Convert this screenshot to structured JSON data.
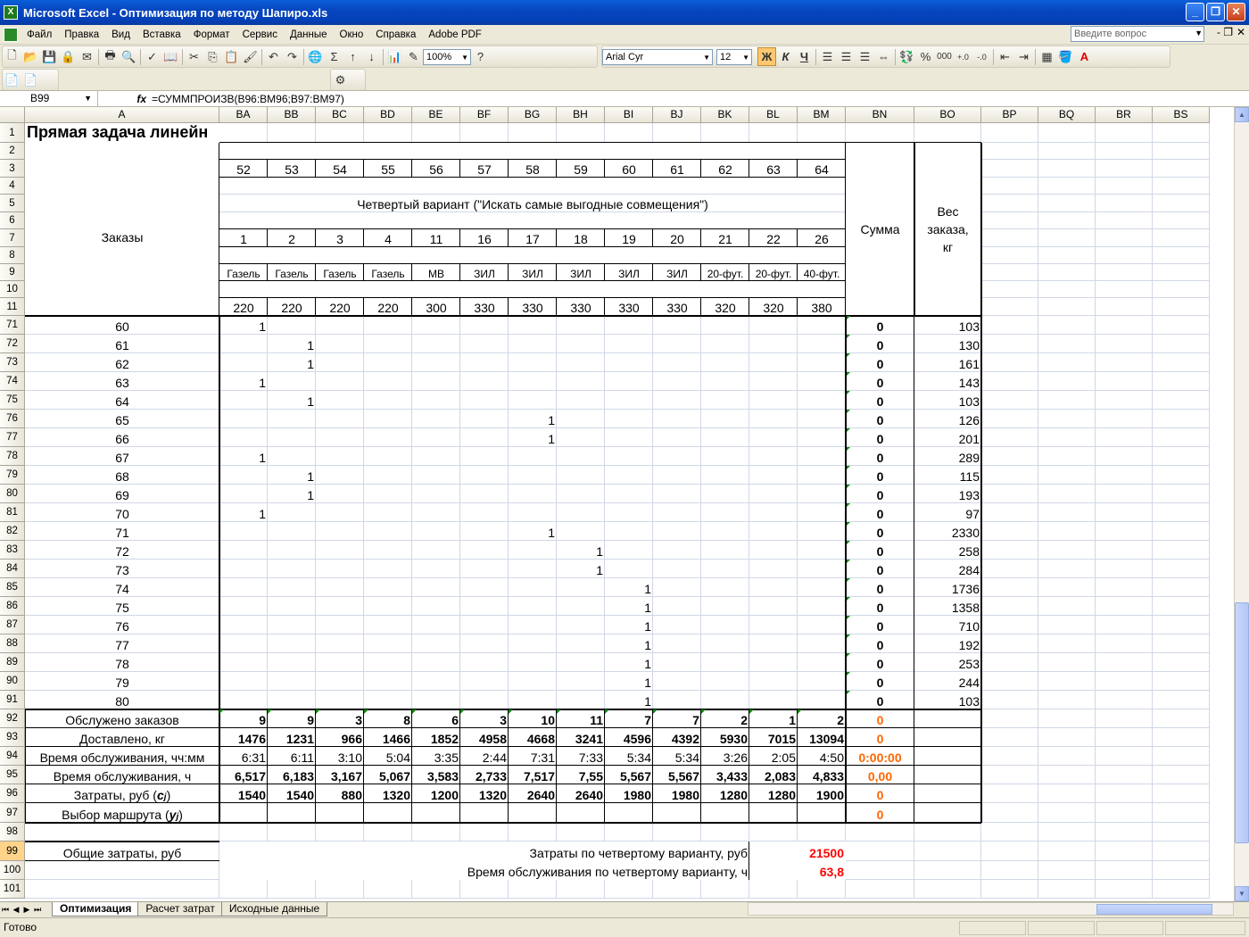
{
  "window": {
    "title": "Microsoft Excel - Оптимизация по методу Шапиро.xls"
  },
  "menu": {
    "items": [
      "Файл",
      "Правка",
      "Вид",
      "Вставка",
      "Формат",
      "Сервис",
      "Данные",
      "Окно",
      "Справка",
      "Adobe PDF"
    ],
    "ask_placeholder": "Введите вопрос"
  },
  "toolbar": {
    "zoom": "100%",
    "font": "Arial Cyr",
    "size": "12",
    "bold": "Ж",
    "italic": "К",
    "underline": "Ч"
  },
  "formula_bar": {
    "name_box": "B99",
    "fx": "fx",
    "formula": "=СУММПРОИЗВ(B96:BM96;B97:BM97)"
  },
  "sheet": {
    "columns": [
      "A",
      "BA",
      "BB",
      "BC",
      "BD",
      "BE",
      "BF",
      "BG",
      "BH",
      "BI",
      "BJ",
      "BK",
      "BL",
      "BM",
      "BN",
      "BO",
      "BP",
      "BQ",
      "BR",
      "BS"
    ],
    "row_numbers": [
      "1",
      "2",
      "3",
      "4",
      "5",
      "6",
      "7",
      "8",
      "9",
      "10",
      "11",
      "71",
      "72",
      "73",
      "74",
      "75",
      "76",
      "77",
      "78",
      "79",
      "80",
      "81",
      "82",
      "83",
      "84",
      "85",
      "86",
      "87",
      "88",
      "89",
      "90",
      "91",
      "92",
      "93",
      "94",
      "95",
      "96",
      "97",
      "98",
      "99",
      "100",
      "101"
    ],
    "selected_row": "99",
    "title": "Прямая задача линейн",
    "orders_label": "Заказы",
    "variant_label": "Четвертый вариант (\"Искать самые выгодные совмещения\")",
    "sum_label": "Сумма",
    "weight_label": [
      "Вес",
      "заказа,",
      "кг"
    ],
    "route_numbers": [
      "52",
      "53",
      "54",
      "55",
      "56",
      "57",
      "58",
      "59",
      "60",
      "61",
      "62",
      "63",
      "64"
    ],
    "vehicle_numbers": [
      "1",
      "2",
      "3",
      "4",
      "11",
      "16",
      "17",
      "18",
      "19",
      "20",
      "21",
      "22",
      "26"
    ],
    "vehicle_types": [
      "Газель",
      "Газель",
      "Газель",
      "Газель",
      "МВ",
      "ЗИЛ",
      "ЗИЛ",
      "ЗИЛ",
      "ЗИЛ",
      "ЗИЛ",
      "20-фут.",
      "20-фут.",
      "40-фут."
    ],
    "vehicle_cost": [
      "220",
      "220",
      "220",
      "220",
      "300",
      "330",
      "330",
      "330",
      "330",
      "330",
      "320",
      "320",
      "380"
    ],
    "order_rows": [
      {
        "order": "60",
        "col": 0,
        "sum": "0",
        "weight": "103"
      },
      {
        "order": "61",
        "col": 1,
        "sum": "0",
        "weight": "130"
      },
      {
        "order": "62",
        "col": 1,
        "sum": "0",
        "weight": "161"
      },
      {
        "order": "63",
        "col": 0,
        "sum": "0",
        "weight": "143"
      },
      {
        "order": "64",
        "col": 1,
        "sum": "0",
        "weight": "103"
      },
      {
        "order": "65",
        "col": 6,
        "sum": "0",
        "weight": "126"
      },
      {
        "order": "66",
        "col": 6,
        "sum": "0",
        "weight": "201"
      },
      {
        "order": "67",
        "col": 0,
        "sum": "0",
        "weight": "289"
      },
      {
        "order": "68",
        "col": 1,
        "sum": "0",
        "weight": "115"
      },
      {
        "order": "69",
        "col": 1,
        "sum": "0",
        "weight": "193"
      },
      {
        "order": "70",
        "col": 0,
        "sum": "0",
        "weight": "97"
      },
      {
        "order": "71",
        "col": 6,
        "sum": "0",
        "weight": "2330"
      },
      {
        "order": "72",
        "col": 7,
        "sum": "0",
        "weight": "258"
      },
      {
        "order": "73",
        "col": 7,
        "sum": "0",
        "weight": "284"
      },
      {
        "order": "74",
        "col": 8,
        "sum": "0",
        "weight": "1736"
      },
      {
        "order": "75",
        "col": 8,
        "sum": "0",
        "weight": "1358"
      },
      {
        "order": "76",
        "col": 8,
        "sum": "0",
        "weight": "710"
      },
      {
        "order": "77",
        "col": 8,
        "sum": "0",
        "weight": "192"
      },
      {
        "order": "78",
        "col": 8,
        "sum": "0",
        "weight": "253"
      },
      {
        "order": "79",
        "col": 8,
        "sum": "0",
        "weight": "244"
      },
      {
        "order": "80",
        "col": 8,
        "sum": "0",
        "weight": "103"
      }
    ],
    "mark": "1",
    "summary_rows": [
      {
        "label": "Обслужено заказов",
        "values": [
          "9",
          "9",
          "3",
          "8",
          "6",
          "3",
          "10",
          "11",
          "7",
          "7",
          "2",
          "1",
          "2"
        ],
        "sum": "0"
      },
      {
        "label": "Доставлено, кг",
        "values": [
          "1476",
          "1231",
          "966",
          "1466",
          "1852",
          "4958",
          "4668",
          "3241",
          "4596",
          "4392",
          "5930",
          "7015",
          "13094"
        ],
        "sum": "0"
      },
      {
        "label": "Время обслуживания, чч:мм",
        "values": [
          "6:31",
          "6:11",
          "3:10",
          "5:04",
          "3:35",
          "2:44",
          "7:31",
          "7:33",
          "5:34",
          "5:34",
          "3:26",
          "2:05",
          "4:50"
        ],
        "sum": "0:00:00"
      },
      {
        "label": "Время обслуживания, ч",
        "values": [
          "6,517",
          "6,183",
          "3,167",
          "5,067",
          "3,583",
          "2,733",
          "7,517",
          "7,55",
          "5,567",
          "5,567",
          "3,433",
          "2,083",
          "4,833"
        ],
        "sum": "0,00"
      },
      {
        "label": "Затраты, руб (cj)",
        "values": [
          "1540",
          "1540",
          "880",
          "1320",
          "1200",
          "1320",
          "2640",
          "2640",
          "1980",
          "1980",
          "1280",
          "1280",
          "1900"
        ],
        "sum": "0"
      },
      {
        "label": "Выбор маршрута (yj)",
        "values": [
          "",
          "",
          "",
          "",
          "",
          "",
          "",
          "",
          "",
          "",
          "",
          "",
          ""
        ],
        "sum": "0"
      }
    ],
    "total_cost_label": "Общие затраты, руб",
    "cost_variant_label": "Затраты по четвертому варианту, руб",
    "cost_variant_value": "21500",
    "time_variant_label": "Время обслуживания по четвертому варианту, ч",
    "time_variant_value": "63,8"
  },
  "tabs": [
    "Оптимизация",
    "Расчет затрат",
    "Исходные данные"
  ],
  "status": {
    "text": "Готово"
  },
  "colors": {
    "orange": "#ff6600",
    "red": "#ff0000",
    "triangle": "#0a8a0a"
  }
}
